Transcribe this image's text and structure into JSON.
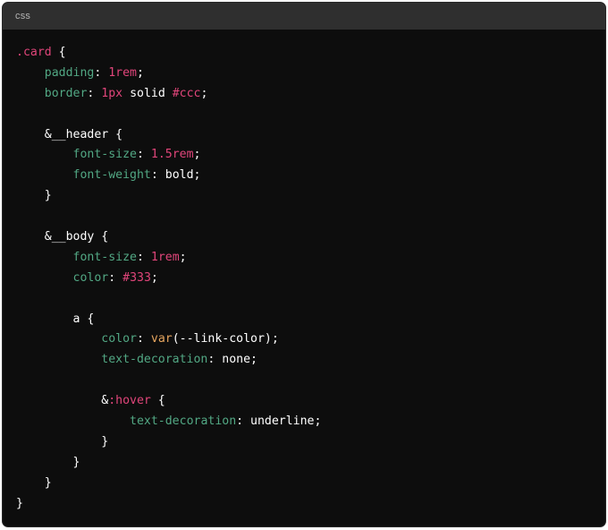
{
  "code_block": {
    "language": "css",
    "lines": [
      [
        {
          "t": ".card",
          "c": "sel"
        },
        {
          "t": " {",
          "c": "plain"
        }
      ],
      [
        {
          "t": "    ",
          "c": "plain"
        },
        {
          "t": "padding",
          "c": "prop"
        },
        {
          "t": ": ",
          "c": "plain"
        },
        {
          "t": "1rem",
          "c": "num"
        },
        {
          "t": ";",
          "c": "plain"
        }
      ],
      [
        {
          "t": "    ",
          "c": "plain"
        },
        {
          "t": "border",
          "c": "prop"
        },
        {
          "t": ": ",
          "c": "plain"
        },
        {
          "t": "1px",
          "c": "num"
        },
        {
          "t": " solid ",
          "c": "plain"
        },
        {
          "t": "#ccc",
          "c": "hex"
        },
        {
          "t": ";",
          "c": "plain"
        }
      ],
      [],
      [
        {
          "t": "    &__header {",
          "c": "plain"
        }
      ],
      [
        {
          "t": "        ",
          "c": "plain"
        },
        {
          "t": "font-size",
          "c": "prop"
        },
        {
          "t": ": ",
          "c": "plain"
        },
        {
          "t": "1.5rem",
          "c": "num"
        },
        {
          "t": ";",
          "c": "plain"
        }
      ],
      [
        {
          "t": "        ",
          "c": "plain"
        },
        {
          "t": "font-weight",
          "c": "prop"
        },
        {
          "t": ": bold;",
          "c": "plain"
        }
      ],
      [
        {
          "t": "    }",
          "c": "plain"
        }
      ],
      [],
      [
        {
          "t": "    &__body {",
          "c": "plain"
        }
      ],
      [
        {
          "t": "        ",
          "c": "plain"
        },
        {
          "t": "font-size",
          "c": "prop"
        },
        {
          "t": ": ",
          "c": "plain"
        },
        {
          "t": "1rem",
          "c": "num"
        },
        {
          "t": ";",
          "c": "plain"
        }
      ],
      [
        {
          "t": "        ",
          "c": "plain"
        },
        {
          "t": "color",
          "c": "prop"
        },
        {
          "t": ": ",
          "c": "plain"
        },
        {
          "t": "#333",
          "c": "hex"
        },
        {
          "t": ";",
          "c": "plain"
        }
      ],
      [],
      [
        {
          "t": "        a {",
          "c": "plain"
        }
      ],
      [
        {
          "t": "            ",
          "c": "plain"
        },
        {
          "t": "color",
          "c": "prop"
        },
        {
          "t": ": ",
          "c": "plain"
        },
        {
          "t": "var",
          "c": "fn"
        },
        {
          "t": "(--link-color);",
          "c": "plain"
        }
      ],
      [
        {
          "t": "            ",
          "c": "plain"
        },
        {
          "t": "text-decoration",
          "c": "prop"
        },
        {
          "t": ": none;",
          "c": "plain"
        }
      ],
      [],
      [
        {
          "t": "            &",
          "c": "plain"
        },
        {
          "t": ":hover",
          "c": "kw"
        },
        {
          "t": " {",
          "c": "plain"
        }
      ],
      [
        {
          "t": "                ",
          "c": "plain"
        },
        {
          "t": "text-decoration",
          "c": "prop"
        },
        {
          "t": ": underline;",
          "c": "plain"
        }
      ],
      [
        {
          "t": "            }",
          "c": "plain"
        }
      ],
      [
        {
          "t": "        }",
          "c": "plain"
        }
      ],
      [
        {
          "t": "    }",
          "c": "plain"
        }
      ],
      [
        {
          "t": "}",
          "c": "plain"
        }
      ]
    ]
  },
  "colors": {
    "background": "#0d0d0d",
    "header_background": "#2f2f2f",
    "selector_keyword": "#e0457a",
    "property": "#52a884",
    "function": "#e5a45e",
    "plain_text": "#ffffff"
  }
}
